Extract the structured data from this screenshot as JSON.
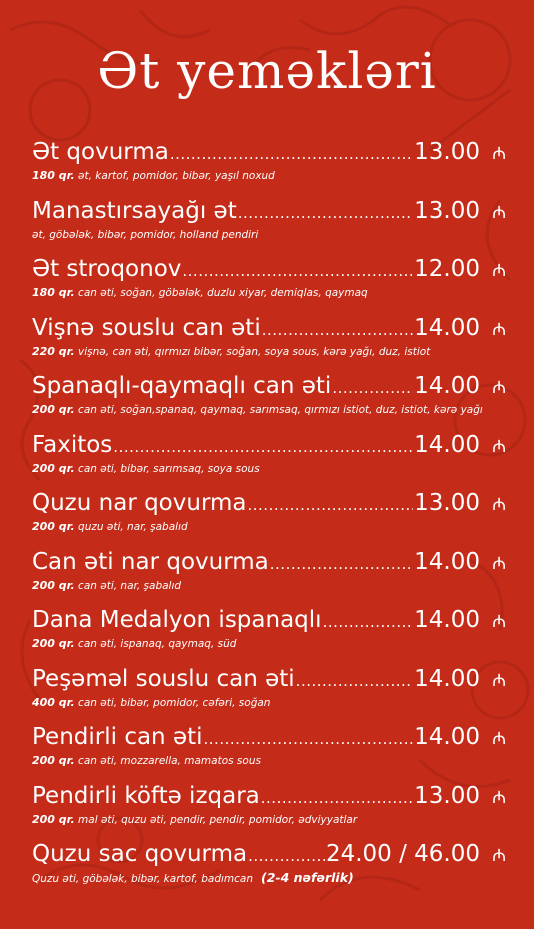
{
  "page": {
    "title": "Ət yeməkləri",
    "background_color": "#c42b19",
    "text_color": "#ffffff",
    "currency_icon": "azn-manat-icon",
    "currency_symbol": "₼"
  },
  "items": [
    {
      "name": "Ət qovurma",
      "price": "13.00",
      "size": "180 qr.",
      "description": "ət, kartof, pomidor, bibər, yaşıl noxud"
    },
    {
      "name": "Manastırsayağı ət",
      "price": "13.00",
      "size": "",
      "description": "ət, göbələk, bibər, pomidor, holland pendiri"
    },
    {
      "name": "Ət stroqonov",
      "price": "12.00",
      "size": "180 qr.",
      "description": "can əti, soğan, göbələk, duzlu xiyar, demiqlas, qaymaq"
    },
    {
      "name": "Vişnə souslu can əti",
      "price": "14.00",
      "size": "220 qr.",
      "description": "vişnə, can əti, qırmızı bibər, soğan, soya sous, kərə yağı, duz, istiot"
    },
    {
      "name": "Spanaqlı-qaymaqlı can əti",
      "price": "14.00",
      "size": "200 qr.",
      "description": "can əti, soğan,spanaq, qaymaq, sarımsaq, qırmızı istiot, duz, istiot, kərə yağı"
    },
    {
      "name": "Faxitos",
      "price": "14.00",
      "size": "200 qr.",
      "description": "can əti, bibər, sarımsaq, soya sous"
    },
    {
      "name": "Quzu nar qovurma",
      "price": "13.00",
      "size": "200 qr.",
      "description": "quzu əti, nar, şabalıd"
    },
    {
      "name": "Can əti nar qovurma",
      "price": "14.00",
      "size": "200 qr.",
      "description": "can əti, nar, şabalıd"
    },
    {
      "name": "Dana Medalyon ispanaqlı",
      "price": "14.00",
      "size": "200 qr.",
      "description": "can əti, ispanaq, qaymaq, süd"
    },
    {
      "name": "Peşəməl souslu can əti",
      "price": "14.00",
      "size": "400 qr.",
      "description": "can əti, bibər, pomidor, cəfəri, soğan"
    },
    {
      "name": "Pendirli can əti",
      "price": "14.00",
      "size": "200 qr.",
      "description": "can əti, mozzarella, mamatos sous"
    },
    {
      "name": "Pendirli köftə izqara",
      "price": "13.00",
      "size": "200 qr.",
      "description": "mal əti, quzu əti, pendir, pendir, pomidor, ədviyyatlar"
    },
    {
      "name": "Quzu sac qovurma",
      "price": "24.00 / 46.00",
      "size": "",
      "description": "Quzu əti, göbələk, bibər, kartof, badımcan",
      "portion": "(2-4 nəfərlik)"
    }
  ]
}
